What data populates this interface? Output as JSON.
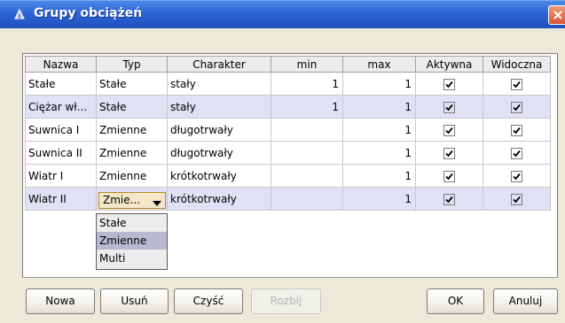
{
  "window": {
    "title": "Grupy obciążeń",
    "title_icon": "load-group-icon",
    "close_icon": "close-icon"
  },
  "table": {
    "columns": [
      "Nazwa",
      "Typ",
      "Charakter",
      "min",
      "max",
      "Aktywna",
      "Widoczna"
    ],
    "rows": [
      {
        "nazwa": "Stałe",
        "typ": "Stałe",
        "charakter": "stały",
        "min": "1",
        "max": "1",
        "aktywna": true,
        "widoczna": true
      },
      {
        "nazwa": "Ciężar wł...",
        "typ": "Stałe",
        "charakter": "stały",
        "min": "1",
        "max": "1",
        "aktywna": true,
        "widoczna": true
      },
      {
        "nazwa": "Suwnica I",
        "typ": "Zmienne",
        "charakter": "długotrwały",
        "min": "",
        "max": "1",
        "aktywna": true,
        "widoczna": true
      },
      {
        "nazwa": "Suwnica II",
        "typ": "Zmienne",
        "charakter": "długotrwały",
        "min": "",
        "max": "1",
        "aktywna": true,
        "widoczna": true
      },
      {
        "nazwa": "Wiatr I",
        "typ": "Zmienne",
        "charakter": "krótkotrwały",
        "min": "",
        "max": "1",
        "aktywna": true,
        "widoczna": true
      },
      {
        "nazwa": "Wiatr II",
        "typ": "Zmie...",
        "charakter": "krótkotrwały",
        "min": "",
        "max": "1",
        "aktywna": true,
        "widoczna": true
      }
    ],
    "selected_rows": [
      1,
      5
    ]
  },
  "type_dropdown": {
    "options": [
      "Stałe",
      "Zmienne",
      "Multi"
    ],
    "highlighted": "Zmienne"
  },
  "buttons": {
    "nowa": "Nowa",
    "usun": "Usuń",
    "czysc": "Czyść",
    "rozbij": "Rozbij",
    "ok": "OK",
    "anuluj": "Anuluj"
  }
}
